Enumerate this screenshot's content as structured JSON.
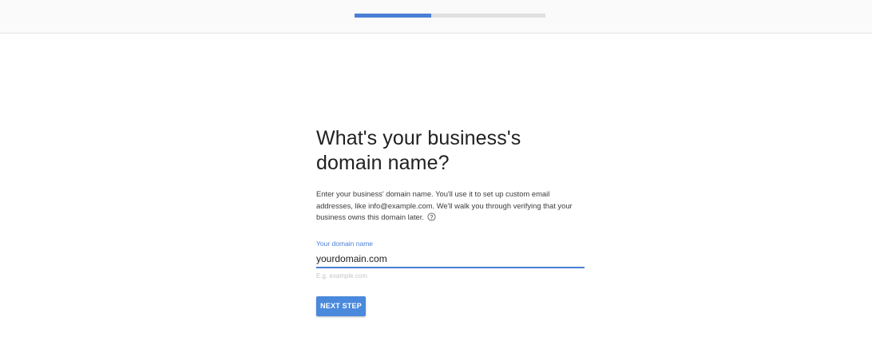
{
  "progress": {
    "value_fraction": 0.4,
    "fill_color": "#4a7fd6",
    "track_color": "#e0e0e0"
  },
  "main": {
    "title": "What's your business's domain name?",
    "description": "Enter your business' domain name. You'll use it to set up custom email addresses, like info@example.com. We'll walk you through verifying that your business owns this domain later.",
    "help_icon": "question-circle-icon",
    "field": {
      "label": "Your domain name",
      "value": "yourdomain.com",
      "hint": "E.g. example.com"
    },
    "next_button_label": "NEXT STEP"
  },
  "colors": {
    "accent": "#4a7fd6",
    "button": "#4a89dc"
  }
}
